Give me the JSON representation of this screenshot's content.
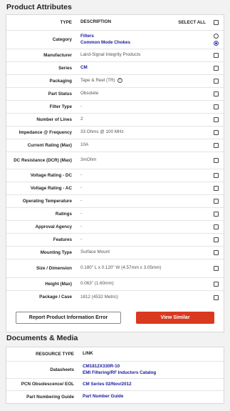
{
  "attributes": {
    "title": "Product Attributes",
    "headers": {
      "type": "TYPE",
      "description": "DESCRIPTION",
      "select_all": "SELECT ALL"
    },
    "rows": [
      {
        "type": "Category",
        "lines": [
          "Filters",
          "Common Mode Chokes"
        ],
        "link": true,
        "control": "radio",
        "selected": 1
      },
      {
        "type": "Manufacturer",
        "value": "Laird-Signal Integrity Products"
      },
      {
        "type": "Series",
        "value": "CM",
        "link": true
      },
      {
        "type": "Packaging",
        "value": "Tape & Reel (TR)",
        "help": true
      },
      {
        "type": "Part Status",
        "value": "Obsolete"
      },
      {
        "type": "Filter Type",
        "value": "-"
      },
      {
        "type": "Number of Lines",
        "value": "2"
      },
      {
        "type": "Impedance @ Frequency",
        "value": "33 Ohms @ 100 MHz"
      },
      {
        "type": "Current Rating (Max)",
        "value": "10A"
      },
      {
        "type": "DC Resistance (DCR) (Max)",
        "value": "3mOhm"
      },
      {
        "type": "Voltage Rating - DC",
        "value": "-"
      },
      {
        "type": "Voltage Rating - AC",
        "value": "-"
      },
      {
        "type": "Operating Temperature",
        "value": "-"
      },
      {
        "type": "Ratings",
        "value": "-"
      },
      {
        "type": "Approval Agency",
        "value": "-"
      },
      {
        "type": "Features",
        "value": "-"
      },
      {
        "type": "Mounting Type",
        "value": "Surface Mount"
      },
      {
        "type": "Size / Dimension",
        "value": "0.180\" L x 0.120\" W (4.57mm x 3.05mm)"
      },
      {
        "type": "Height (Max)",
        "value": "0.063\" (1.60mm)"
      },
      {
        "type": "Package / Case",
        "value": "1812 (4532 Metric)"
      }
    ],
    "report_button": "Report Product Information Error",
    "view_similar_button": "View Similar",
    "accent_color": "#d9391f"
  },
  "documents": {
    "title": "Documents & Media",
    "headers": {
      "resource_type": "RESOURCE TYPE",
      "link": "LINK"
    },
    "rows": [
      {
        "type": "Datasheets",
        "links": [
          "CM1812X330R-10",
          "EMI Filtering/RF Inductors Catalog"
        ]
      },
      {
        "type": "PCN Obsolescence/ EOL",
        "links": [
          "CM Series 02/Nov/2012"
        ]
      },
      {
        "type": "Part Numbering Guide",
        "links": [
          "Part Number Guide"
        ]
      }
    ]
  }
}
